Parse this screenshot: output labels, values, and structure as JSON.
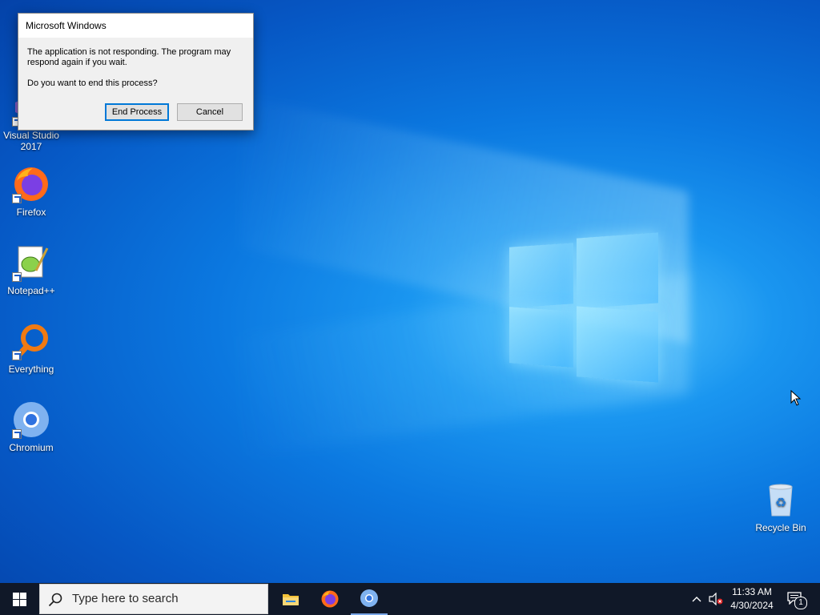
{
  "dialog": {
    "title": "Microsoft Windows",
    "message_1": "The application is not responding. The program may respond again if you wait.",
    "message_2": "Do you want to end this process?",
    "end_process_label": "End Process",
    "cancel_label": "Cancel"
  },
  "desktop_icons": {
    "visual_studio": "Visual Studio 2017",
    "firefox": "Firefox",
    "notepadpp": "Notepad++",
    "everything": "Everything",
    "chromium": "Chromium",
    "recycle_bin": "Recycle Bin"
  },
  "taskbar": {
    "search_placeholder": "Type here to search",
    "time": "11:33 AM",
    "date": "4/30/2024",
    "notification_count": "1"
  },
  "colors": {
    "taskbar_bg": "#101828",
    "accent": "#0078d7"
  }
}
